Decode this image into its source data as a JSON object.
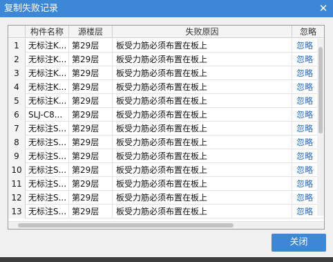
{
  "dialog": {
    "title": "复制失败记录",
    "close_icon": "close-icon",
    "close_glyph": "✕"
  },
  "table": {
    "columns": [
      "",
      "构件名称",
      "源楼层",
      "失败原因",
      "忽略"
    ],
    "rows": [
      {
        "idx": "1",
        "name": "无标注K...",
        "floor": "第29层",
        "reason": "板受力筋必须布置在板上",
        "action": "忽略"
      },
      {
        "idx": "2",
        "name": "无标注K...",
        "floor": "第29层",
        "reason": "板受力筋必须布置在板上",
        "action": "忽略"
      },
      {
        "idx": "3",
        "name": "无标注K...",
        "floor": "第29层",
        "reason": "板受力筋必须布置在板上",
        "action": "忽略"
      },
      {
        "idx": "4",
        "name": "无标注K...",
        "floor": "第29层",
        "reason": "板受力筋必须布置在板上",
        "action": "忽略"
      },
      {
        "idx": "5",
        "name": "无标注K...",
        "floor": "第29层",
        "reason": "板受力筋必须布置在板上",
        "action": "忽略"
      },
      {
        "idx": "6",
        "name": "SLJ-C8...",
        "floor": "第29层",
        "reason": "板受力筋必须布置在板上",
        "action": "忽略"
      },
      {
        "idx": "7",
        "name": "无标注S...",
        "floor": "第29层",
        "reason": "板受力筋必须布置在板上",
        "action": "忽略"
      },
      {
        "idx": "8",
        "name": "无标注S...",
        "floor": "第29层",
        "reason": "板受力筋必须布置在板上",
        "action": "忽略"
      },
      {
        "idx": "9",
        "name": "无标注S...",
        "floor": "第29层",
        "reason": "板受力筋必须布置在板上",
        "action": "忽略"
      },
      {
        "idx": "10",
        "name": "无标注S...",
        "floor": "第29层",
        "reason": "板受力筋必须布置在板上",
        "action": "忽略"
      },
      {
        "idx": "11",
        "name": "无标注S...",
        "floor": "第29层",
        "reason": "板受力筋必须布置在板上",
        "action": "忽略"
      },
      {
        "idx": "12",
        "name": "无标注S...",
        "floor": "第29层",
        "reason": "板受力筋必须布置在板上",
        "action": "忽略"
      },
      {
        "idx": "13",
        "name": "无标注S...",
        "floor": "第29层",
        "reason": "板受力筋必须布置在板上",
        "action": "忽略"
      }
    ]
  },
  "footer": {
    "close_label": "关闭"
  },
  "colors": {
    "accent": "#3d88d6",
    "link": "#2468c4"
  }
}
